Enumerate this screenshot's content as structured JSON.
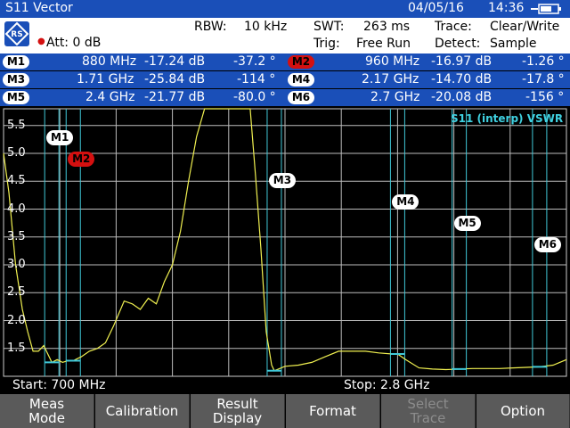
{
  "title_bar": {
    "mode": "S11 Vector",
    "date": "04/05/16",
    "time": "14:36"
  },
  "settings": {
    "att": "Att: 0 dB",
    "rbw_label": "RBW:",
    "rbw_value": "10 kHz",
    "swt_label": "SWT:",
    "swt_value": "263 ms",
    "trace_label": "Trace:",
    "trace_value": "Clear/Write",
    "trig_label": "Trig:",
    "trig_value": "Free Run",
    "detect_label": "Detect:",
    "detect_value": "Sample"
  },
  "markers": [
    {
      "id": "M1",
      "freq": "880 MHz",
      "mag": "-17.24 dB",
      "phase": "-37.2 °",
      "active": false
    },
    {
      "id": "M2",
      "freq": "960 MHz",
      "mag": "-16.97 dB",
      "phase": "-1.26 °",
      "active": true
    },
    {
      "id": "M3",
      "freq": "1.71 GHz",
      "mag": "-25.84 dB",
      "phase": "-114 °",
      "active": false
    },
    {
      "id": "M4",
      "freq": "2.17 GHz",
      "mag": "-14.70 dB",
      "phase": "-17.8 °",
      "active": false
    },
    {
      "id": "M5",
      "freq": "2.4 GHz",
      "mag": "-21.77 dB",
      "phase": "-80.0 °",
      "active": false
    },
    {
      "id": "M6",
      "freq": "2.7 GHz",
      "mag": "-20.08 dB",
      "phase": "-156 °",
      "active": false
    }
  ],
  "plot": {
    "trace_label": "S11 (interp) VSWR",
    "y_ticks": [
      "5.5",
      "5.0",
      "4.5",
      "4.0",
      "3.5",
      "3.0",
      "2.5",
      "2.0",
      "1.5"
    ]
  },
  "chart_data": {
    "type": "line",
    "title": "S11 (interp) VSWR",
    "xlabel": "",
    "ylabel": "",
    "xlim": [
      700,
      2800
    ],
    "ylim": [
      1.0,
      5.8
    ],
    "series": [
      {
        "name": "S11 (interp) VSWR",
        "x": [
          700,
          720,
          745,
          770,
          790,
          810,
          830,
          850,
          870,
          880,
          900,
          920,
          940,
          960,
          990,
          1020,
          1050,
          1080,
          1110,
          1150,
          1180,
          1210,
          1240,
          1270,
          1300,
          1330,
          1360,
          1390,
          1420,
          1450,
          1470,
          1490,
          1500,
          1520,
          1540,
          1560,
          1580,
          1600,
          1620,
          1640,
          1660,
          1680,
          1700,
          1710,
          1750,
          1800,
          1850,
          1900,
          1950,
          2000,
          2050,
          2100,
          2150,
          2170,
          2200,
          2250,
          2300,
          2350,
          2400,
          2450,
          2500,
          2550,
          2600,
          2650,
          2700,
          2750,
          2800
        ],
        "y": [
          5.0,
          4.3,
          3.0,
          2.2,
          1.8,
          1.45,
          1.45,
          1.55,
          1.35,
          1.25,
          1.3,
          1.25,
          1.28,
          1.28,
          1.35,
          1.45,
          1.5,
          1.6,
          1.9,
          2.35,
          2.3,
          2.2,
          2.4,
          2.3,
          2.7,
          3.0,
          3.6,
          4.5,
          5.3,
          5.8,
          5.8,
          5.8,
          5.8,
          5.8,
          5.8,
          5.8,
          5.8,
          5.8,
          5.8,
          4.6,
          3.3,
          1.8,
          1.2,
          1.1,
          1.18,
          1.2,
          1.25,
          1.35,
          1.45,
          1.45,
          1.45,
          1.42,
          1.4,
          1.4,
          1.3,
          1.15,
          1.13,
          1.12,
          1.13,
          1.14,
          1.14,
          1.14,
          1.15,
          1.16,
          1.17,
          1.2,
          1.3
        ]
      }
    ],
    "markers_x": [
      880,
      960,
      1710,
      2170,
      2400,
      2700
    ],
    "grid": true
  },
  "span": {
    "start": "Start:  700 MHz",
    "stop": "Stop:     2.8 GHz"
  },
  "softkeys": [
    {
      "label": "Meas Mode",
      "enabled": true
    },
    {
      "label": "Calibration",
      "enabled": true
    },
    {
      "label": "Result Display",
      "enabled": true
    },
    {
      "label": "Format",
      "enabled": true
    },
    {
      "label": "Select Trace",
      "enabled": false
    },
    {
      "label": "Option",
      "enabled": true
    }
  ]
}
